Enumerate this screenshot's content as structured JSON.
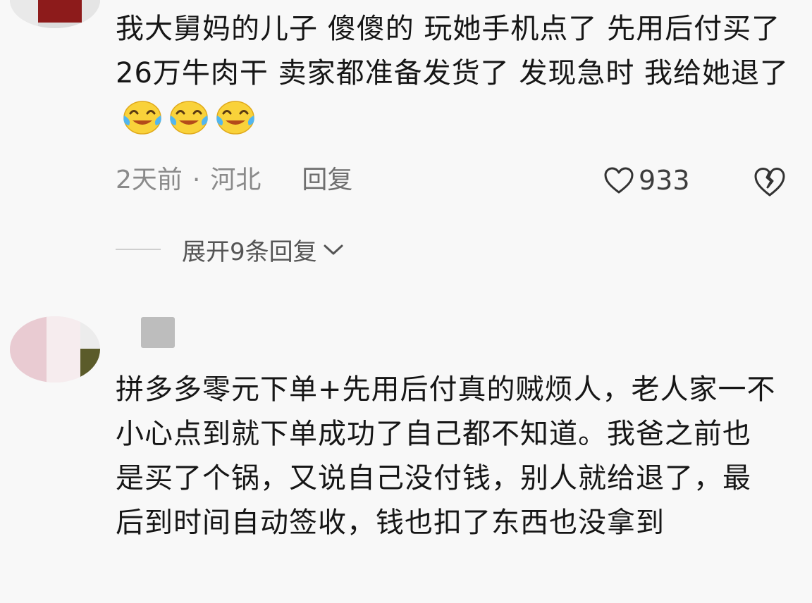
{
  "comments": [
    {
      "text": "我大舅妈的儿子 傻傻的 玩她手机点了 先用后付买了26万牛肉干 卖家都准备发货了 发现急时  我给她退了",
      "emoji": [
        "laugh-cry-emoji",
        "laugh-cry-emoji",
        "laugh-cry-emoji"
      ],
      "time": "2天前",
      "separator": "·",
      "location": "河北",
      "reply_label": "回复",
      "like_count": "933",
      "expand_label": "展开9条回复"
    },
    {
      "text": "拼多多零元下单+先用后付真的贼烦人，老人家一不小心点到就下单成功了自己都不知道。我爸之前也是买了个锅，又说自己没付钱，别人就给退了，最后到时间自动签收，钱也扣了东西也没拿到"
    }
  ],
  "colors": {
    "background": "#f8f8f8",
    "text": "#161616",
    "meta": "#8a8a8a",
    "avatar1_accent": "#8d1b1b"
  },
  "icons": {
    "like": "heart-outline-icon",
    "dislike": "broken-heart-icon",
    "expand": "chevron-down-icon"
  }
}
